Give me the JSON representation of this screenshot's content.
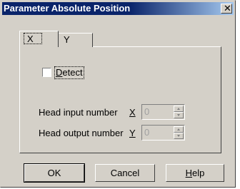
{
  "window": {
    "title": "Parameter Absolute Position",
    "close_symbol": "✕"
  },
  "tabs": [
    {
      "label": "X",
      "selected": true
    },
    {
      "label": "Y",
      "selected": false
    }
  ],
  "detect": {
    "label_underlined": "D",
    "label_rest": "etect",
    "checked": false
  },
  "head_input": {
    "label": "Head input number",
    "axis_label": "X",
    "value": "0"
  },
  "head_output": {
    "label": "Head output number",
    "axis_label": "Y",
    "value": "0"
  },
  "buttons": {
    "ok": "OK",
    "cancel": "Cancel",
    "help_underlined": "H",
    "help_rest": "elp"
  }
}
